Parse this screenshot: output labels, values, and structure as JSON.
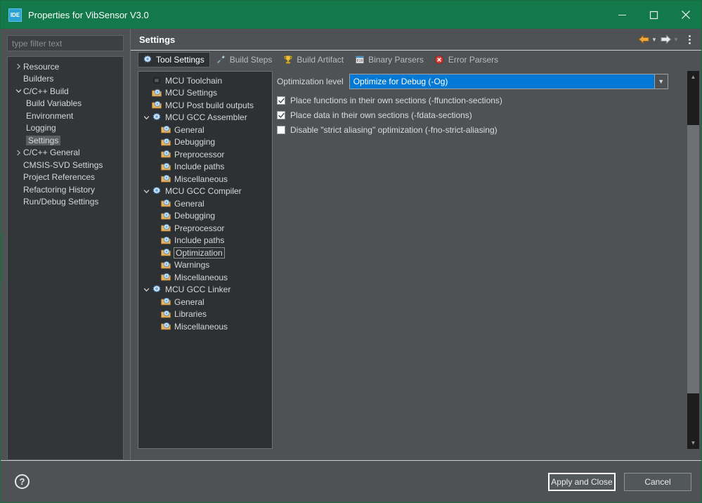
{
  "window": {
    "logo_text": "IDE",
    "title": "Properties for VibSensor V3.0",
    "minimize_label": "Minimize",
    "maximize_label": "Maximize",
    "close_label": "Close",
    "accent_color": "#14794a"
  },
  "sidebar": {
    "filter_placeholder": "type filter text",
    "items": [
      {
        "label": "Resource",
        "indent": 0,
        "arrow": "collapsed"
      },
      {
        "label": "Builders",
        "indent": 0,
        "arrow": "none"
      },
      {
        "label": "C/C++ Build",
        "indent": 0,
        "arrow": "expanded"
      },
      {
        "label": "Build Variables",
        "indent": 1,
        "arrow": "none"
      },
      {
        "label": "Environment",
        "indent": 1,
        "arrow": "none"
      },
      {
        "label": "Logging",
        "indent": 1,
        "arrow": "none"
      },
      {
        "label": "Settings",
        "indent": 1,
        "arrow": "none",
        "selected": true
      },
      {
        "label": "C/C++ General",
        "indent": 0,
        "arrow": "collapsed"
      },
      {
        "label": "CMSIS-SVD Settings",
        "indent": 0,
        "arrow": "none"
      },
      {
        "label": "Project References",
        "indent": 0,
        "arrow": "none"
      },
      {
        "label": "Refactoring History",
        "indent": 0,
        "arrow": "none"
      },
      {
        "label": "Run/Debug Settings",
        "indent": 0,
        "arrow": "none"
      }
    ]
  },
  "page": {
    "title": "Settings",
    "back_icon": "back-arrow-icon",
    "forward_icon": "forward-arrow-icon",
    "menu_icon": "kebab-menu-icon"
  },
  "tabs": [
    {
      "label": "Tool Settings",
      "icon": "tool-settings-icon",
      "active": true
    },
    {
      "label": "Build Steps",
      "icon": "build-steps-icon",
      "active": false
    },
    {
      "label": "Build Artifact",
      "icon": "trophy-icon",
      "active": false
    },
    {
      "label": "Binary Parsers",
      "icon": "binary-parsers-icon",
      "active": false
    },
    {
      "label": "Error Parsers",
      "icon": "error-parsers-icon",
      "active": false
    }
  ],
  "tool_tree": [
    {
      "label": "MCU Toolchain",
      "indent": 0,
      "arrow": "none",
      "icon": "chip-icon"
    },
    {
      "label": "MCU Settings",
      "indent": 0,
      "arrow": "none",
      "icon": "folder-gear-icon"
    },
    {
      "label": "MCU Post build outputs",
      "indent": 0,
      "arrow": "none",
      "icon": "folder-gear-icon"
    },
    {
      "label": "MCU GCC Assembler",
      "indent": 0,
      "arrow": "expanded",
      "icon": "gear-icon"
    },
    {
      "label": "General",
      "indent": 1,
      "arrow": "none",
      "icon": "folder-gear-icon"
    },
    {
      "label": "Debugging",
      "indent": 1,
      "arrow": "none",
      "icon": "folder-gear-icon"
    },
    {
      "label": "Preprocessor",
      "indent": 1,
      "arrow": "none",
      "icon": "folder-gear-icon"
    },
    {
      "label": "Include paths",
      "indent": 1,
      "arrow": "none",
      "icon": "folder-gear-icon"
    },
    {
      "label": "Miscellaneous",
      "indent": 1,
      "arrow": "none",
      "icon": "folder-gear-icon"
    },
    {
      "label": "MCU GCC Compiler",
      "indent": 0,
      "arrow": "expanded",
      "icon": "gear-icon"
    },
    {
      "label": "General",
      "indent": 1,
      "arrow": "none",
      "icon": "folder-gear-icon"
    },
    {
      "label": "Debugging",
      "indent": 1,
      "arrow": "none",
      "icon": "folder-gear-icon"
    },
    {
      "label": "Preprocessor",
      "indent": 1,
      "arrow": "none",
      "icon": "folder-gear-icon"
    },
    {
      "label": "Include paths",
      "indent": 1,
      "arrow": "none",
      "icon": "folder-gear-icon"
    },
    {
      "label": "Optimization",
      "indent": 1,
      "arrow": "none",
      "icon": "folder-gear-icon",
      "selected": true
    },
    {
      "label": "Warnings",
      "indent": 1,
      "arrow": "none",
      "icon": "folder-gear-icon"
    },
    {
      "label": "Miscellaneous",
      "indent": 1,
      "arrow": "none",
      "icon": "folder-gear-icon"
    },
    {
      "label": "MCU GCC Linker",
      "indent": 0,
      "arrow": "expanded",
      "icon": "gear-icon"
    },
    {
      "label": "General",
      "indent": 1,
      "arrow": "none",
      "icon": "folder-gear-icon"
    },
    {
      "label": "Libraries",
      "indent": 1,
      "arrow": "none",
      "icon": "folder-gear-icon"
    },
    {
      "label": "Miscellaneous",
      "indent": 1,
      "arrow": "none",
      "icon": "folder-gear-icon"
    }
  ],
  "form": {
    "optimization_label": "Optimization level",
    "optimization_value": "Optimize for Debug (-Og)",
    "combo_highlight_color": "#0078d4",
    "checkboxes": [
      {
        "label": "Place functions in their own sections (-ffunction-sections)",
        "checked": true
      },
      {
        "label": "Place data in their own sections (-fdata-sections)",
        "checked": true
      },
      {
        "label": "Disable \"strict aliasing\" optimization (-fno-strict-aliasing)",
        "checked": false
      }
    ]
  },
  "footer": {
    "help_label": "?",
    "apply_label": "Apply and Close",
    "cancel_label": "Cancel"
  }
}
